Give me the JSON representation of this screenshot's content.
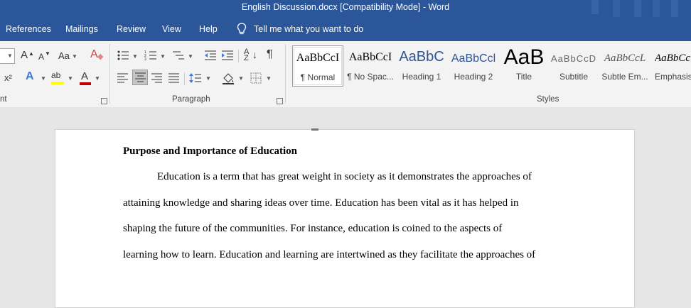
{
  "window": {
    "title": "English Discussion.docx [Compatibility Mode]  -  Word"
  },
  "tabs": [
    {
      "label": "References"
    },
    {
      "label": "Mailings"
    },
    {
      "label": "Review"
    },
    {
      "label": "View"
    },
    {
      "label": "Help"
    }
  ],
  "tell_me": {
    "label": "Tell me what you want to do"
  },
  "ribbon": {
    "groups": {
      "font": "nt",
      "paragraph": "Paragraph",
      "styles": "Styles"
    },
    "icons": {
      "grow_font": "A",
      "shrink_font": "A",
      "change_case": "Aa",
      "superscript": "x²",
      "sort": "A↓Z",
      "pilcrow": "¶"
    }
  },
  "styles": [
    {
      "sample": "AaBbCcI",
      "name": "¶ Normal"
    },
    {
      "sample": "AaBbCcI",
      "name": "¶ No Spac..."
    },
    {
      "sample": "AaBbC",
      "name": "Heading 1"
    },
    {
      "sample": "AaBbCcl",
      "name": "Heading 2"
    },
    {
      "sample": "AaB",
      "name": "Title"
    },
    {
      "sample": "AaBbCcD",
      "name": "Subtitle"
    },
    {
      "sample": "AaBbCcL",
      "name": "Subtle Em..."
    },
    {
      "sample": "AaBbCc",
      "name": "Emphasis"
    }
  ],
  "document": {
    "heading": "Purpose and Importance of Education",
    "lines": [
      "Education is a term that has great weight in society as it demonstrates the approaches of",
      "attaining knowledge and sharing ideas over time. Education has been vital as it has helped in",
      "shaping the future of the communities. For instance, education is coined to the aspects of",
      "learning how to learn. Education and learning are intertwined as they facilitate the approaches of"
    ]
  },
  "colors": {
    "word_blue": "#2b579a",
    "ribbon_bg": "#f3f3f3",
    "highlight_yellow": "#ffff00",
    "font_color_red": "#c00000",
    "heading_blue": "#2f5496"
  }
}
